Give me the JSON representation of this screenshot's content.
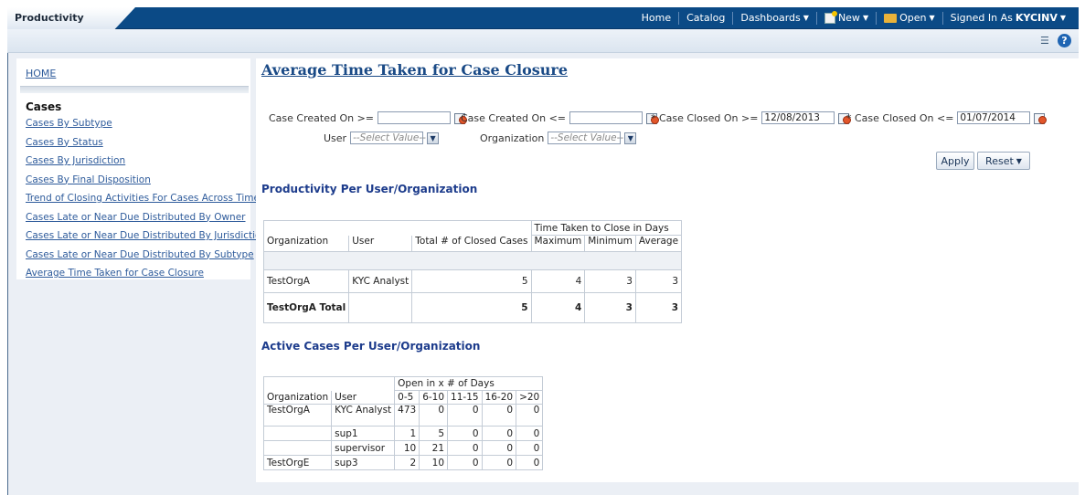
{
  "header": {
    "app_tab": "Productivity",
    "nav": {
      "home": "Home",
      "catalog": "Catalog",
      "dashboards": "Dashboards",
      "new": "New",
      "open": "Open",
      "signed_in_label": "Signed In As",
      "user": "KYCINV"
    }
  },
  "sidebar": {
    "home": "HOME",
    "section": "Cases",
    "links": [
      "Cases By Subtype",
      "Cases By Status",
      "Cases By Jurisdiction",
      "Cases By Final Disposition",
      "Trend of Closing Activities For Cases Across Time",
      "Cases Late or Near Due Distributed By Owner",
      "Cases Late or Near Due Distributed By Jurisdiction",
      "Cases Late or Near Due Distributed By Subtype",
      "Average Time Taken for Case Closure"
    ]
  },
  "main": {
    "title": "Average Time Taken for Case Closure",
    "filters": {
      "created_from_label": "Case Created On  >=",
      "created_from_value": "",
      "created_to_label": "Case Created On  <=",
      "created_to_value": "",
      "closed_from_label": "* Case Closed On  >=",
      "closed_from_value": "12/08/2013",
      "closed_to_label": "* Case Closed On  <=",
      "closed_to_value": "01/07/2014",
      "user_label": "User",
      "user_value": "--Select Value--",
      "org_label": "Organization",
      "org_value": "--Select Value--"
    },
    "buttons": {
      "apply": "Apply",
      "reset": "Reset"
    },
    "productivity": {
      "title": "Productivity Per User/Organization",
      "group_header": "Time Taken to Close in Days",
      "headers": [
        "Organization",
        "User",
        "Total # of Closed Cases",
        "Maximum",
        "Minimum",
        "Average"
      ],
      "rows": [
        [
          "TestOrgA",
          "KYC Analyst",
          "5",
          "4",
          "3",
          "3"
        ],
        [
          "TestOrgA Total",
          "",
          "5",
          "4",
          "3",
          "3"
        ]
      ]
    },
    "active": {
      "title": "Active Cases Per User/Organization",
      "group_header": "Open in x # of Days",
      "headers": [
        "Organization",
        "User",
        "0-5",
        "6-10",
        "11-15",
        "16-20",
        ">20"
      ],
      "rows": [
        [
          "TestOrgA",
          "KYC Analyst",
          "473",
          "0",
          "0",
          "0",
          "0"
        ],
        [
          "",
          "sup1",
          "1",
          "5",
          "0",
          "0",
          "0"
        ],
        [
          "",
          "supervisor",
          "10",
          "21",
          "0",
          "0",
          "0"
        ],
        [
          "TestOrgE",
          "sup3",
          "2",
          "10",
          "0",
          "0",
          "0"
        ]
      ]
    }
  }
}
